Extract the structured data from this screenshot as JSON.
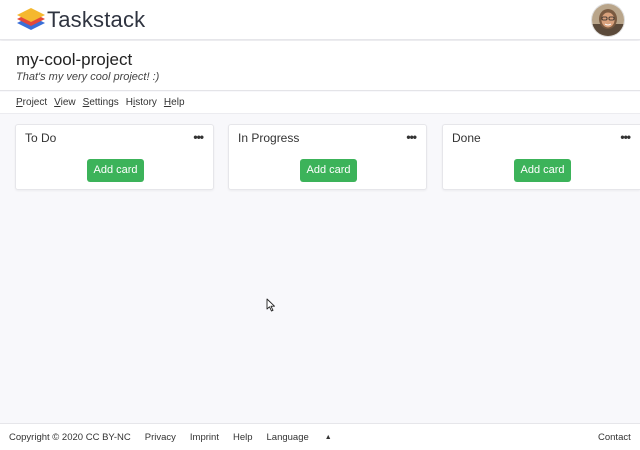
{
  "app": {
    "name": "Taskstack",
    "logo_icon": "stacked-layers-logo",
    "avatar_icon": "user-avatar"
  },
  "project": {
    "title": "my-cool-project",
    "description": "That's my very cool project! :)"
  },
  "menu": {
    "items": [
      {
        "key": "P",
        "rest": "roject"
      },
      {
        "key": "V",
        "rest": "iew"
      },
      {
        "key": "S",
        "rest": "ettings"
      },
      {
        "pre": "H",
        "key": "i",
        "rest": "story"
      },
      {
        "key": "H",
        "rest": "elp"
      }
    ]
  },
  "columns": [
    {
      "title": "To Do",
      "menu": "•••",
      "add_label": "Add card"
    },
    {
      "title": "In Progress",
      "menu": "•••",
      "add_label": "Add card"
    },
    {
      "title": "Done",
      "menu": "•••",
      "add_label": "Add card"
    }
  ],
  "footer": {
    "copyright": "Copyright © 2020 CC BY-NC",
    "privacy": "Privacy",
    "imprint": "Imprint",
    "help": "Help",
    "language": "Language",
    "language_caret": "▲",
    "contact": "Contact"
  },
  "colors": {
    "accent_green": "#3cb35a",
    "logo_red": "#e4483b",
    "logo_yellow": "#f5b82e",
    "logo_blue": "#3a6fd8"
  }
}
